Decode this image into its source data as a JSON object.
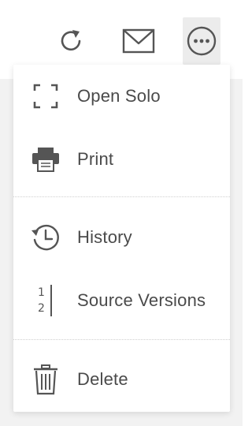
{
  "toolbar": {
    "refresh_icon": "refresh-icon",
    "mail_icon": "mail-icon",
    "more_icon": "more-options-icon"
  },
  "menu": {
    "items": [
      {
        "label": "Open Solo",
        "icon": "fullscreen-icon"
      },
      {
        "label": "Print",
        "icon": "printer-icon"
      },
      {
        "label": "History",
        "icon": "history-icon"
      },
      {
        "label": "Source Versions",
        "icon": "source-versions-icon",
        "icon_text": [
          "1",
          "2"
        ]
      },
      {
        "label": "Delete",
        "icon": "trash-icon"
      }
    ]
  },
  "colors": {
    "icon": "#555555",
    "text": "#4a4a4a",
    "divider": "#cfcfcf",
    "active_button_bg": "#ececec"
  }
}
